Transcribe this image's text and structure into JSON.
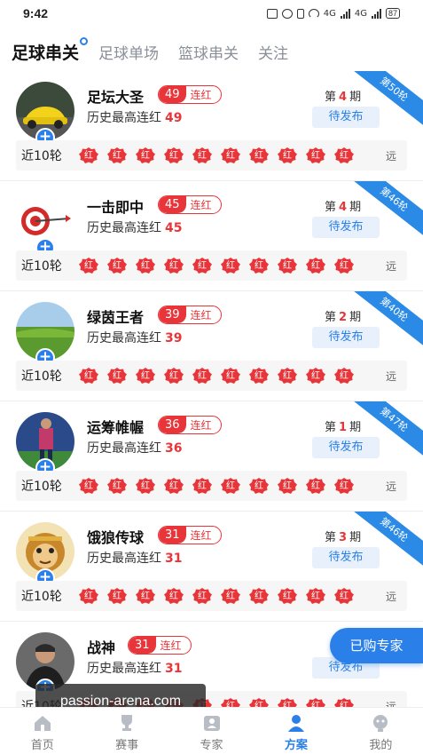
{
  "status_bar": {
    "time": "9:42",
    "net1": "4G",
    "net2": "4G",
    "battery": "87"
  },
  "tabs": [
    {
      "label": "足球串关",
      "active": true
    },
    {
      "label": "足球单场",
      "active": false
    },
    {
      "label": "篮球串关",
      "active": false
    },
    {
      "label": "关注",
      "active": false
    }
  ],
  "cards": [
    {
      "name": "足坛大圣",
      "streak": "49",
      "streak_label": "连红",
      "history_label": "历史最高连红",
      "history_value": "49",
      "period_prefix": "第",
      "period_num": "4",
      "period_suffix": "期",
      "status": "待发布",
      "round": "第50轮",
      "recent_label": "近10轮",
      "far_label": "远",
      "badge": "红",
      "avatar": "car"
    },
    {
      "name": "一击即中",
      "streak": "45",
      "streak_label": "连红",
      "history_label": "历史最高连红",
      "history_value": "45",
      "period_prefix": "第",
      "period_num": "4",
      "period_suffix": "期",
      "status": "待发布",
      "round": "第46轮",
      "recent_label": "近10轮",
      "far_label": "远",
      "badge": "红",
      "avatar": "target"
    },
    {
      "name": "绿茵王者",
      "streak": "39",
      "streak_label": "连红",
      "history_label": "历史最高连红",
      "history_value": "39",
      "period_prefix": "第",
      "period_num": "2",
      "period_suffix": "期",
      "status": "待发布",
      "round": "第40轮",
      "recent_label": "近10轮",
      "far_label": "远",
      "badge": "红",
      "avatar": "field"
    },
    {
      "name": "运筹帷幄",
      "streak": "36",
      "streak_label": "连红",
      "history_label": "历史最高连红",
      "history_value": "36",
      "period_prefix": "第",
      "period_num": "1",
      "period_suffix": "期",
      "status": "待发布",
      "round": "第47轮",
      "recent_label": "近10轮",
      "far_label": "远",
      "badge": "红",
      "avatar": "player"
    },
    {
      "name": "饿狼传球",
      "streak": "31",
      "streak_label": "连红",
      "history_label": "历史最高连红",
      "history_value": "31",
      "period_prefix": "第",
      "period_num": "3",
      "period_suffix": "期",
      "status": "待发布",
      "round": "第46轮",
      "recent_label": "近10轮",
      "far_label": "远",
      "badge": "红",
      "avatar": "monkey"
    },
    {
      "name": "战神",
      "streak": "31",
      "streak_label": "连红",
      "history_label": "历史最高连红",
      "history_value": "31",
      "period_prefix": "",
      "period_num": "",
      "period_suffix": "",
      "status": "待发布",
      "round": "",
      "recent_label": "近10轮",
      "far_label": "远",
      "badge": "红",
      "avatar": "man"
    }
  ],
  "purchased_button": "已购专家",
  "watermark": "passion-arena.com",
  "bottom_nav": [
    {
      "label": "首页",
      "icon": "home-icon",
      "active": false
    },
    {
      "label": "赛事",
      "icon": "trophy-icon",
      "active": false
    },
    {
      "label": "专家",
      "icon": "expert-icon",
      "active": false
    },
    {
      "label": "方案",
      "icon": "plan-icon",
      "active": true
    },
    {
      "label": "我的",
      "icon": "profile-icon",
      "active": false
    }
  ],
  "colors": {
    "accent": "#2a7fe8",
    "red": "#e8353a"
  }
}
